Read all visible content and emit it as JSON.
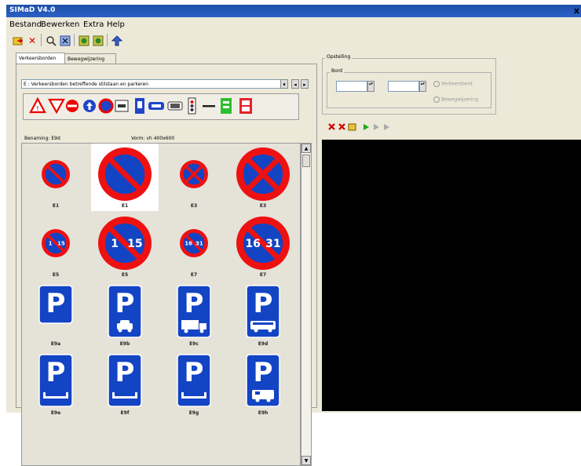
{
  "window": {
    "title": "SIMaD V4.0",
    "close_glyph": "x"
  },
  "menu": [
    "Bestand",
    "Bewerken",
    "Extra",
    "Help"
  ],
  "tabs": [
    "Verkeersborden",
    "Bewegwijzering"
  ],
  "category_dropdown": {
    "value": "E : Verkeersborden betreffende stilstaan en parkeren"
  },
  "column_headers": {
    "left": "Benaming: E9d",
    "right": "Vorm: vh 400x600"
  },
  "signs": [
    {
      "code": "E1",
      "type": "noparking"
    },
    {
      "code": "E1",
      "type": "noparking",
      "selected": true
    },
    {
      "code": "E3",
      "type": "nostop"
    },
    {
      "code": "E3",
      "type": "nostop"
    },
    {
      "code": "E5",
      "type": "alt",
      "text": "1 15"
    },
    {
      "code": "E5",
      "type": "alt",
      "text": "1 15"
    },
    {
      "code": "E7",
      "type": "alt",
      "text": "16 31"
    },
    {
      "code": "E7",
      "type": "alt",
      "text": "16 31"
    },
    {
      "code": "E9a",
      "type": "parking",
      "extra": ""
    },
    {
      "code": "E9b",
      "type": "parking",
      "extra": "car"
    },
    {
      "code": "E9c",
      "type": "parking",
      "extra": "truck"
    },
    {
      "code": "E9d",
      "type": "parking",
      "extra": "bus"
    },
    {
      "code": "E9e",
      "type": "parking",
      "extra": "pavement"
    },
    {
      "code": "E9f",
      "type": "parking",
      "extra": "pavement"
    },
    {
      "code": "E9g",
      "type": "parking",
      "extra": "pavement"
    },
    {
      "code": "E9h",
      "type": "parking",
      "extra": "camper"
    }
  ],
  "sign_letter": "P",
  "opstelling": {
    "group_title": "Opstelling",
    "bord_title": "Bord",
    "radio1": "Verkeersbord",
    "radio2": "Bewegwijzering"
  },
  "colors": {
    "sign_red": "#ee1111",
    "sign_blue": "#1244c4",
    "titlebar": "#2a5fc7"
  }
}
